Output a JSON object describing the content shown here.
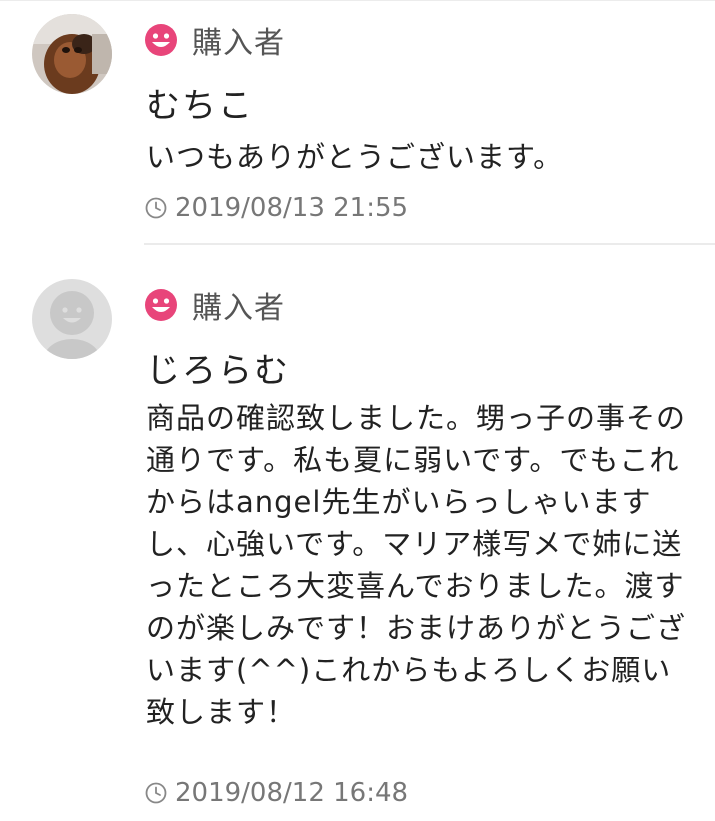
{
  "comments": [
    {
      "badge": "購入者",
      "name": "むちこ",
      "text": "いつもありがとうございます。",
      "time": "2019/08/13 21:55",
      "avatar": "photo-avatar"
    },
    {
      "badge": "購入者",
      "name": "じろらむ",
      "text": "商品の確認致しました。甥っ子の事その通りです。私も夏に弱いです。でもこれからはangel先生がいらっしゃいますし、心強いです。マリア様写メで姉に送ったところ大変喜んでおりました。渡すのが楽しみです！おまけありがとうございます(^^)これからもよろしくお願い致します！",
      "time": "2019/08/12 16:48",
      "avatar": "default-avatar"
    }
  ],
  "colors": {
    "badge_pink": "#e8457a",
    "text": "#222222",
    "muted": "#777777",
    "divider": "#ebebeb"
  }
}
